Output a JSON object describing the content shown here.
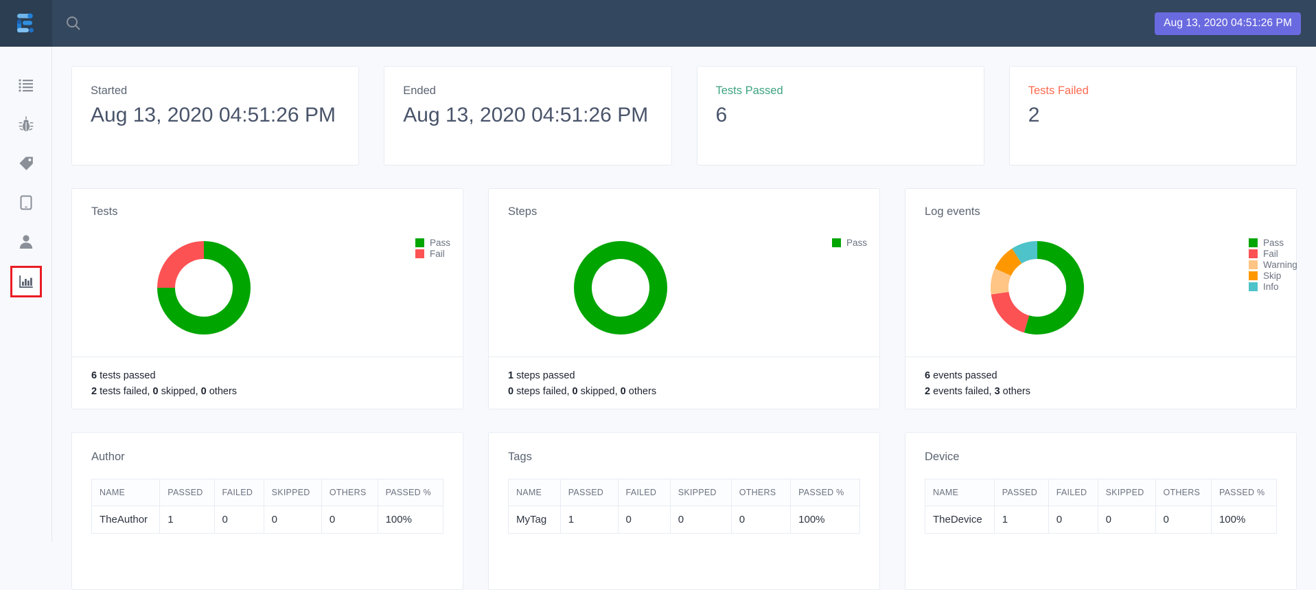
{
  "topbar": {
    "logo_icon": "allure-logo-icon",
    "search_icon": "search-icon",
    "timestamp_badge": "Aug 13, 2020 04:51:26 PM",
    "badge_color": "#6a6ae0"
  },
  "sidebar": {
    "items": [
      {
        "name": "suites",
        "icon": "list-icon",
        "active": false
      },
      {
        "name": "behaviors",
        "icon": "bug-icon",
        "active": false
      },
      {
        "name": "tags",
        "icon": "tag-icon",
        "active": false
      },
      {
        "name": "devices",
        "icon": "tablet-icon",
        "active": false
      },
      {
        "name": "authors",
        "icon": "user-icon",
        "active": false
      },
      {
        "name": "graphs",
        "icon": "bar-chart-icon",
        "active": true
      }
    ],
    "highlight_color": "#ea1c24"
  },
  "summary": {
    "cards": [
      {
        "label": "Started",
        "value": "Aug 13, 2020 04:51:26 PM",
        "style": "default"
      },
      {
        "label": "Ended",
        "value": "Aug 13, 2020 04:51:26 PM",
        "style": "default"
      },
      {
        "label": "Tests Passed",
        "value": "6",
        "style": "pass"
      },
      {
        "label": "Tests Failed",
        "value": "2",
        "style": "fail"
      }
    ]
  },
  "colors": {
    "pass": "#00a500",
    "fail": "#fc5254",
    "warning": "#ffc585",
    "skip": "#ff9800",
    "info": "#4ec3c9",
    "pass_text": "#3ca37f",
    "fail_text": "#fc6a4f"
  },
  "charts": [
    {
      "title": "Tests",
      "footer_line1_count": "6",
      "footer_line1_text": " tests passed",
      "footer_line2": {
        "failed_count": "2",
        "failed_text": " tests failed, ",
        "skipped_count": "0",
        "skipped_text": " skipped, ",
        "others_count": "0",
        "others_text": " others"
      },
      "legend": [
        {
          "label": "Pass",
          "color": "#00a500"
        },
        {
          "label": "Fail",
          "color": "#fc5254"
        }
      ]
    },
    {
      "title": "Steps",
      "footer_line1_count": "1",
      "footer_line1_text": " steps passed",
      "footer_line2": {
        "failed_count": "0",
        "failed_text": " steps failed, ",
        "skipped_count": "0",
        "skipped_text": " skipped, ",
        "others_count": "0",
        "others_text": " others"
      },
      "legend": [
        {
          "label": "Pass",
          "color": "#00a500"
        }
      ]
    },
    {
      "title": "Log events",
      "footer_line1_count": "6",
      "footer_line1_text": " events passed",
      "footer_line2": {
        "failed_count": "2",
        "failed_text": " events failed, ",
        "skipped_count": "3",
        "skipped_text": " others",
        "others_count": "",
        "others_text": ""
      },
      "legend": [
        {
          "label": "Pass",
          "color": "#00a500"
        },
        {
          "label": "Fail",
          "color": "#fc5254"
        },
        {
          "label": "Warning",
          "color": "#ffc585"
        },
        {
          "label": "Skip",
          "color": "#ff9800"
        },
        {
          "label": "Info",
          "color": "#4ec3c9"
        }
      ]
    }
  ],
  "chart_data": [
    {
      "type": "pie",
      "title": "Tests",
      "labels": [
        "Pass",
        "Fail"
      ],
      "values": [
        6,
        2
      ],
      "colors": [
        "#00a500",
        "#fc5254"
      ],
      "legend_position": "right",
      "donut": true
    },
    {
      "type": "pie",
      "title": "Steps",
      "labels": [
        "Pass"
      ],
      "values": [
        1
      ],
      "colors": [
        "#00a500"
      ],
      "legend_position": "right",
      "donut": true
    },
    {
      "type": "pie",
      "title": "Log events",
      "labels": [
        "Pass",
        "Fail",
        "Warning",
        "Skip",
        "Info"
      ],
      "values": [
        6,
        2,
        1,
        1,
        1
      ],
      "colors": [
        "#00a500",
        "#fc5254",
        "#ffc585",
        "#ff9800",
        "#4ec3c9"
      ],
      "legend_position": "right",
      "donut": true
    }
  ],
  "tables": [
    {
      "title": "Author",
      "headers": [
        "NAME",
        "PASSED",
        "FAILED",
        "SKIPPED",
        "OTHERS",
        "PASSED %"
      ],
      "rows": [
        [
          "TheAuthor",
          "1",
          "0",
          "0",
          "0",
          "100%"
        ]
      ]
    },
    {
      "title": "Tags",
      "headers": [
        "NAME",
        "PASSED",
        "FAILED",
        "SKIPPED",
        "OTHERS",
        "PASSED %"
      ],
      "rows": [
        [
          "MyTag",
          "1",
          "0",
          "0",
          "0",
          "100%"
        ]
      ]
    },
    {
      "title": "Device",
      "headers": [
        "NAME",
        "PASSED",
        "FAILED",
        "SKIPPED",
        "OTHERS",
        "PASSED %"
      ],
      "rows": [
        [
          "TheDevice",
          "1",
          "0",
          "0",
          "0",
          "100%"
        ]
      ]
    }
  ]
}
